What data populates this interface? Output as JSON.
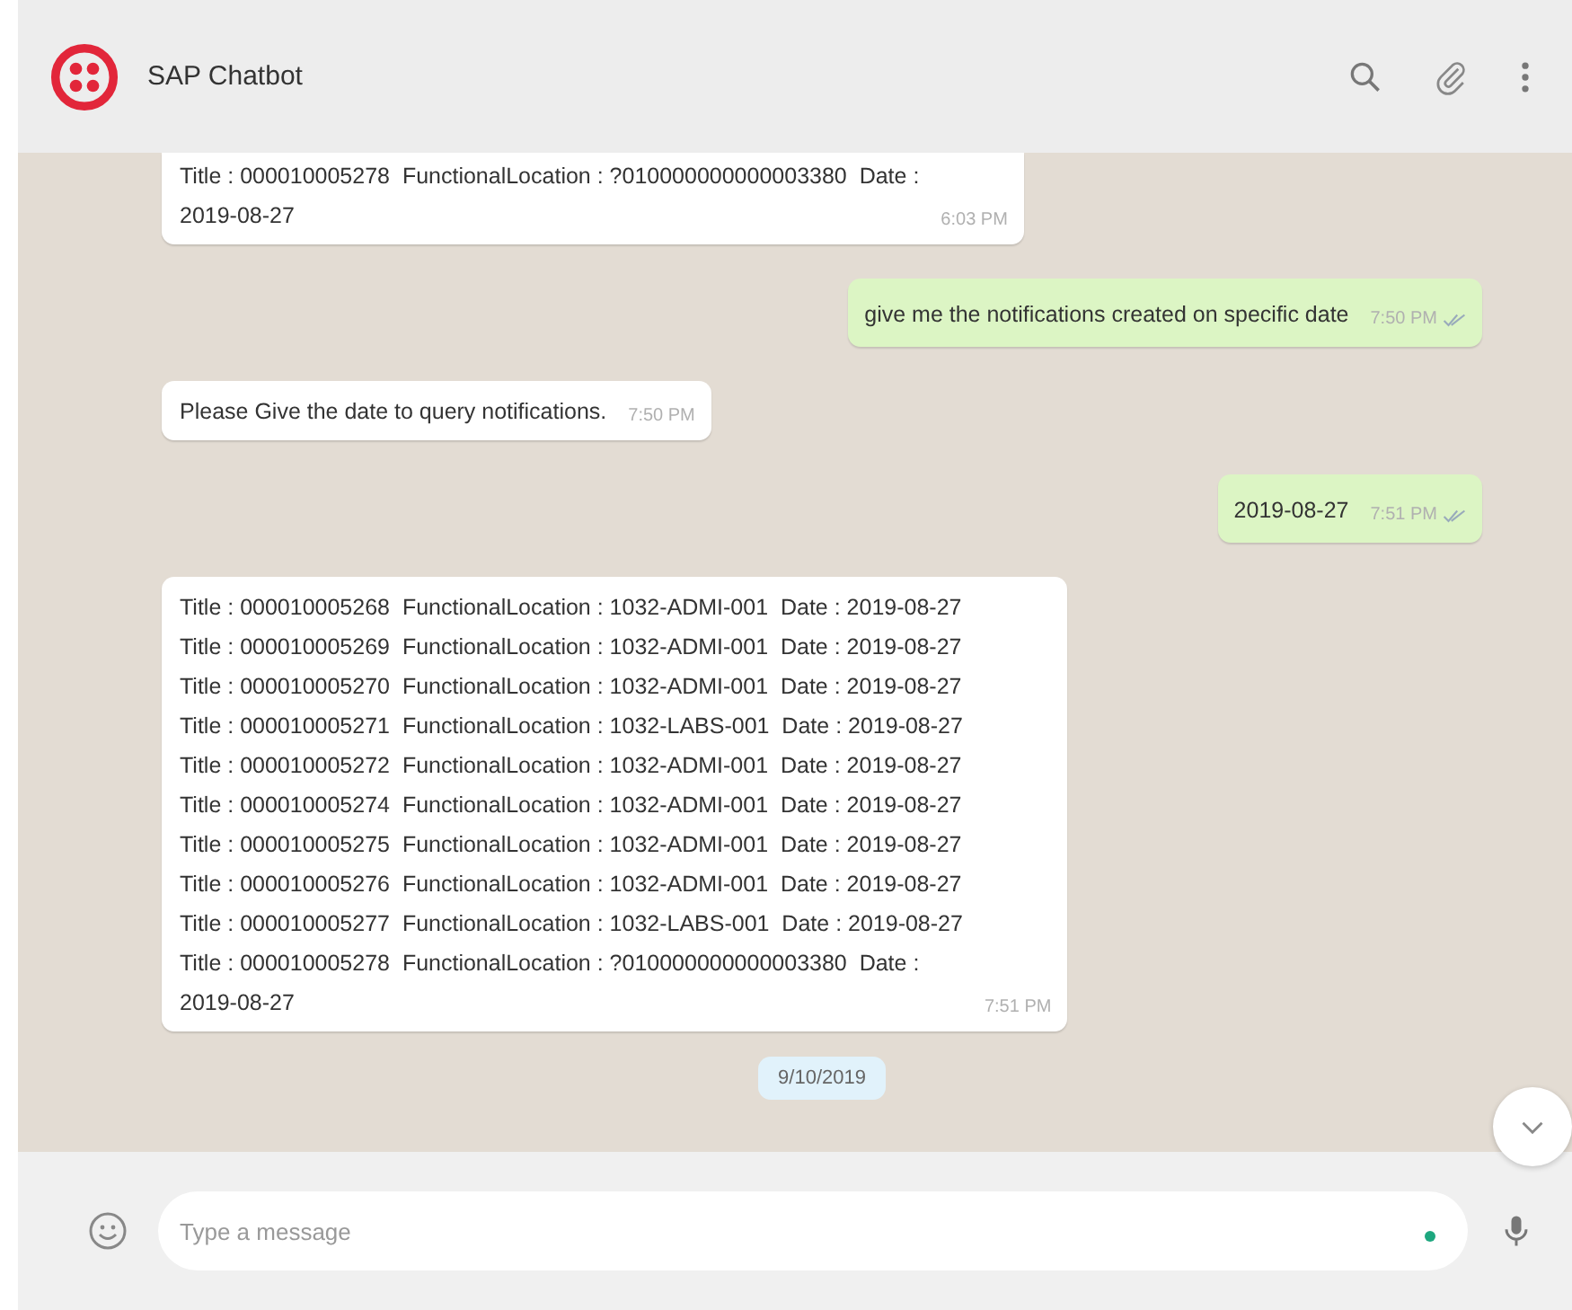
{
  "header": {
    "title": "SAP Chatbot"
  },
  "messages": [
    {
      "kind": "incoming",
      "lines": [
        "Title : 000010005278  FunctionalLocation : ?010000000000003380  Date :",
        "2019-08-27"
      ],
      "time": "6:03 PM"
    },
    {
      "kind": "outgoing",
      "lines": [
        "give me the notifications created on specific date"
      ],
      "time": "7:50 PM"
    },
    {
      "kind": "incoming",
      "lines": [
        "Please Give the date to query notifications."
      ],
      "time": "7:50 PM"
    },
    {
      "kind": "outgoing",
      "lines": [
        "2019-08-27"
      ],
      "time": "7:51 PM"
    },
    {
      "kind": "incoming",
      "lines": [
        "Title : 000010005268  FunctionalLocation : 1032-ADMI-001  Date : 2019-08-27",
        "Title : 000010005269  FunctionalLocation : 1032-ADMI-001  Date : 2019-08-27",
        "Title : 000010005270  FunctionalLocation : 1032-ADMI-001  Date : 2019-08-27",
        "Title : 000010005271  FunctionalLocation : 1032-LABS-001  Date : 2019-08-27",
        "Title : 000010005272  FunctionalLocation : 1032-ADMI-001  Date : 2019-08-27",
        "Title : 000010005274  FunctionalLocation : 1032-ADMI-001  Date : 2019-08-27",
        "Title : 000010005275  FunctionalLocation : 1032-ADMI-001  Date : 2019-08-27",
        "Title : 000010005276  FunctionalLocation : 1032-ADMI-001  Date : 2019-08-27",
        "Title : 000010005277  FunctionalLocation : 1032-LABS-001  Date : 2019-08-27",
        "Title : 000010005278  FunctionalLocation : ?010000000000003380  Date :",
        "2019-08-27"
      ],
      "time": "7:51 PM"
    },
    {
      "kind": "date",
      "lines": [
        "9/10/2019"
      ]
    }
  ],
  "composer": {
    "placeholder": "Type a message"
  }
}
